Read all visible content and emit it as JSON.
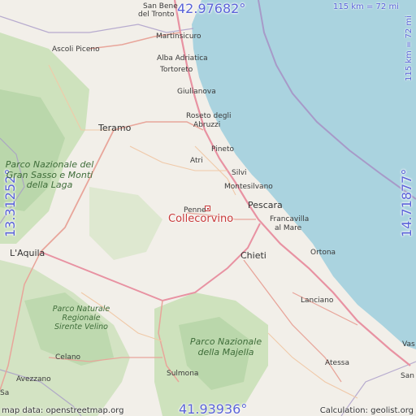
{
  "map": {
    "colors": {
      "land": "#f2efe9",
      "sea": "#aad3df",
      "forest": "#add19e",
      "park": "#c8dfb5",
      "road": "#e8a59a",
      "motorway": "#e892a2",
      "border": "#a79ac8",
      "accent": "#5a63d8",
      "place": "#c83a3a"
    },
    "coords": {
      "top": "42.97682°",
      "bottom": "41.93936°",
      "left": "13.31252°",
      "right": "14.71877°"
    },
    "scale": {
      "top": "115 km = 72 mi",
      "right": "115 km = 72 mi"
    },
    "place": {
      "name": "Collecorvino",
      "marker_icon": "square-marker-icon"
    },
    "towns": {
      "san_benedetto": "San Bene",
      "san_benedetto2": "del Tronto",
      "martinsicuro": "Martinsicuro",
      "ascoli": "Ascoli Piceno",
      "alba": "Alba Adriatica",
      "tortoreto": "Tortoreto",
      "giulianova": "Giulianova",
      "roseto": "Roseto degli",
      "roseto2": "Abruzzi",
      "teramo": "Teramo",
      "pineto": "Pineto",
      "atri": "Atri",
      "silvi": "Silvi",
      "montesilvano": "Montesilvano",
      "pescara": "Pescara",
      "penne": "Penne",
      "francavilla": "Francavilla",
      "francavilla2": "al Mare",
      "laquila": "L'Aquila",
      "chieti": "Chieti",
      "ortona": "Ortona",
      "lanciano": "Lanciano",
      "vasto": "Vas",
      "celano": "Celano",
      "sulmona": "Sulmona",
      "atessa": "Atessa",
      "avezzano": "Avezzano",
      "san_salvo": "San",
      "sora": "Sa"
    },
    "parks": {
      "gran_sasso": "Parco Nazionale del Gran Sasso e Monti della Laga",
      "sirente": "Parco Naturale Regionale Sirente Velino",
      "majella": "Parco Nazionale della Majella"
    },
    "footer": {
      "attribution": "map data: openstreetmap.org",
      "calc": "Calculation: geolist.org"
    }
  }
}
